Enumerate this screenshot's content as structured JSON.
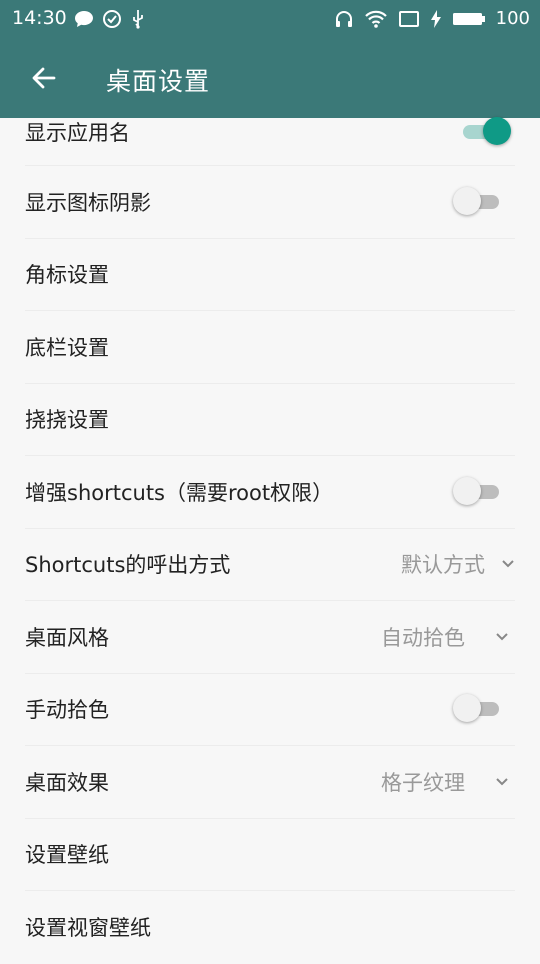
{
  "status_bar": {
    "time": "14:30",
    "battery_level": "100",
    "icons": [
      "chat-bubble-icon",
      "check-circle-icon",
      "usb-icon",
      "headphones-icon",
      "wifi-icon",
      "cast-icon",
      "charging-bolt-icon",
      "battery-icon"
    ]
  },
  "app_bar": {
    "title": "桌面设置",
    "color": "#3b7978",
    "back_icon": "arrow-left-icon"
  },
  "settings": [
    {
      "label": "显示应用名",
      "type": "switch",
      "on": true
    },
    {
      "label": "显示图标阴影",
      "type": "switch",
      "on": false
    },
    {
      "label": "角标设置",
      "type": "link"
    },
    {
      "label": "底栏设置",
      "type": "link"
    },
    {
      "label": "挠挠设置",
      "type": "link"
    },
    {
      "label": "增强shortcuts（需要root权限）",
      "type": "switch",
      "on": false
    },
    {
      "label": "Shortcuts的呼出方式",
      "type": "select",
      "value": "默认方式"
    },
    {
      "label": "桌面风格",
      "type": "select",
      "value": "自动拾色"
    },
    {
      "label": "手动拾色",
      "type": "switch",
      "on": false
    },
    {
      "label": "桌面效果",
      "type": "select",
      "value": "格子纹理"
    },
    {
      "label": "设置壁纸",
      "type": "link"
    },
    {
      "label": "设置视窗壁纸",
      "type": "link"
    }
  ],
  "colors": {
    "accent": "#0f9a86",
    "switch_off_track": "#bdbdbd",
    "secondary_text": "#999999"
  }
}
